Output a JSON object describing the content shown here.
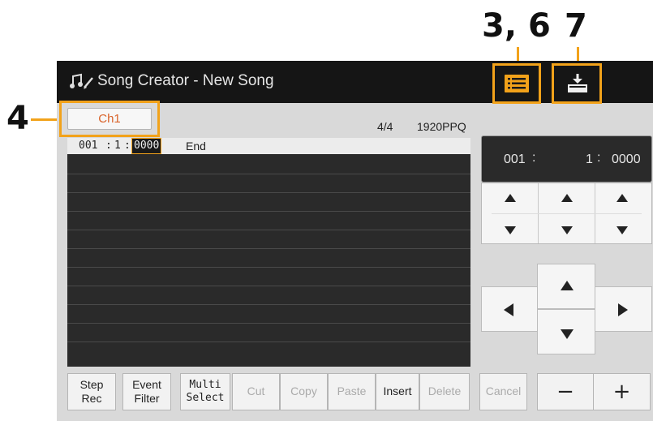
{
  "callouts": {
    "c36": "3, 6",
    "c7": "7",
    "c4": "4"
  },
  "header": {
    "title": "Song Creator - New Song"
  },
  "channel": {
    "label": "Ch1"
  },
  "song_info": {
    "time_signature": "4/4",
    "resolution": "1920PPQ"
  },
  "event_list": {
    "first_row": {
      "measure": "001",
      "beat": "1",
      "clock": "0000",
      "event": "End"
    }
  },
  "position": {
    "measure": "001",
    "beat": "1",
    "clock": "0000"
  },
  "buttons": {
    "step_rec": [
      "Step",
      "Rec"
    ],
    "event_filter": [
      "Event",
      "Filter"
    ],
    "multi_select": [
      "Multi",
      "Select"
    ],
    "cut": "Cut",
    "copy": "Copy",
    "paste": "Paste",
    "insert": "Insert",
    "delete": "Delete",
    "cancel": "Cancel",
    "minus": "−",
    "plus": "+"
  },
  "colors": {
    "accent": "#f2a21a",
    "channel_text": "#d9632a",
    "list_bg": "#2a2a2a"
  }
}
